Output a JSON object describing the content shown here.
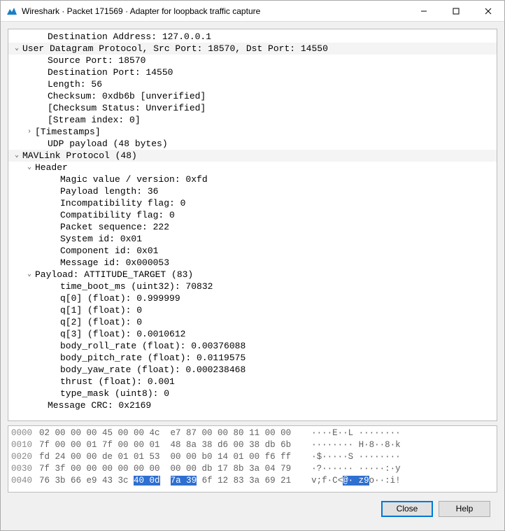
{
  "window": {
    "title": "Wireshark · Packet 171569 · Adapter for loopback traffic capture"
  },
  "tree": [
    {
      "indent": 2,
      "arrow": "",
      "text": "Destination Address: 127.0.0.1",
      "header": false
    },
    {
      "indent": 0,
      "arrow": "v",
      "text": "User Datagram Protocol, Src Port: 18570, Dst Port: 14550",
      "header": true
    },
    {
      "indent": 2,
      "arrow": "",
      "text": "Source Port: 18570"
    },
    {
      "indent": 2,
      "arrow": "",
      "text": "Destination Port: 14550"
    },
    {
      "indent": 2,
      "arrow": "",
      "text": "Length: 56"
    },
    {
      "indent": 2,
      "arrow": "",
      "text": "Checksum: 0xdb6b [unverified]"
    },
    {
      "indent": 2,
      "arrow": "",
      "text": "[Checksum Status: Unverified]"
    },
    {
      "indent": 2,
      "arrow": "",
      "text": "[Stream index: 0]"
    },
    {
      "indent": 1,
      "arrow": ">",
      "text": "[Timestamps]"
    },
    {
      "indent": 2,
      "arrow": "",
      "text": "UDP payload (48 bytes)"
    },
    {
      "indent": 0,
      "arrow": "v",
      "text": "MAVLink Protocol (48)",
      "header": true
    },
    {
      "indent": 1,
      "arrow": "v",
      "text": "Header"
    },
    {
      "indent": 3,
      "arrow": "",
      "text": "Magic value / version: 0xfd"
    },
    {
      "indent": 3,
      "arrow": "",
      "text": "Payload length: 36"
    },
    {
      "indent": 3,
      "arrow": "",
      "text": "Incompatibility flag: 0"
    },
    {
      "indent": 3,
      "arrow": "",
      "text": "Compatibility flag: 0"
    },
    {
      "indent": 3,
      "arrow": "",
      "text": "Packet sequence: 222"
    },
    {
      "indent": 3,
      "arrow": "",
      "text": "System id: 0x01"
    },
    {
      "indent": 3,
      "arrow": "",
      "text": "Component id: 0x01"
    },
    {
      "indent": 3,
      "arrow": "",
      "text": "Message id: 0x000053"
    },
    {
      "indent": 1,
      "arrow": "v",
      "text": "Payload: ATTITUDE_TARGET (83)"
    },
    {
      "indent": 3,
      "arrow": "",
      "text": "time_boot_ms (uint32): 70832"
    },
    {
      "indent": 3,
      "arrow": "",
      "text": "q[0] (float): 0.999999"
    },
    {
      "indent": 3,
      "arrow": "",
      "text": "q[1] (float): 0"
    },
    {
      "indent": 3,
      "arrow": "",
      "text": "q[2] (float): 0"
    },
    {
      "indent": 3,
      "arrow": "",
      "text": "q[3] (float): 0.0010612"
    },
    {
      "indent": 3,
      "arrow": "",
      "text": "body_roll_rate (float): 0.00376088"
    },
    {
      "indent": 3,
      "arrow": "",
      "text": "body_pitch_rate (float): 0.0119575"
    },
    {
      "indent": 3,
      "arrow": "",
      "text": "body_yaw_rate (float): 0.000238468"
    },
    {
      "indent": 3,
      "arrow": "",
      "text": "thrust (float): 0.001"
    },
    {
      "indent": 3,
      "arrow": "",
      "text": "type_mask (uint8): 0"
    },
    {
      "indent": 2,
      "arrow": "",
      "text": "Message CRC: 0x2169"
    }
  ],
  "hex": [
    {
      "off": "0000",
      "b1": "02 00 00 00 45 00 00 4c",
      "b2": "e7 87 00 00 80 11 00 00",
      "ascii": "····E··L ········"
    },
    {
      "off": "0010",
      "b1": "7f 00 00 01 7f 00 00 01",
      "b2": "48 8a 38 d6 00 38 db 6b",
      "ascii": "········ H·8··8·k"
    },
    {
      "off": "0020",
      "b1": "fd 24 00 00 de 01 01 53",
      "b2": "00 00 b0 14 01 00 f6 ff",
      "ascii": "·$·····S ········"
    },
    {
      "off": "0030",
      "b1": "7f 3f 00 00 00 00 00 00",
      "b2": "00 00 db 17 8b 3a 04 79",
      "ascii": "·?······ ·····:·y"
    },
    {
      "off": "0040",
      "b1_pre": "76 3b 66 e9 43 3c ",
      "b1_sel": "40 0d",
      "b2_pre": "",
      "b2_sel": "7a 39",
      "b2_post": " 6f 12 83 3a 69 21",
      "ascii_pre": "v;f·C<",
      "ascii_sel": "@· z9",
      "ascii_post": "o··:i!"
    }
  ],
  "buttons": {
    "close": "Close",
    "help": "Help"
  }
}
